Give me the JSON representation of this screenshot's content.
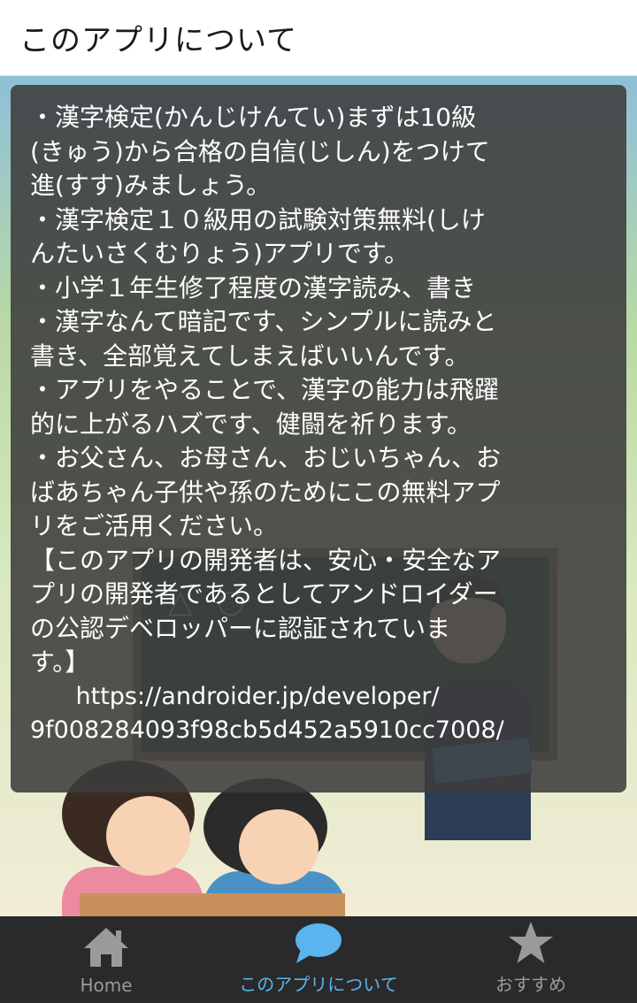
{
  "app_bar": {
    "title": "このアプリについて"
  },
  "background": {
    "board_marks": "△ ○"
  },
  "info": {
    "body": "・漢字検定(かんじけんてい)まずは10級\n(きゅう)から合格の自信(じしん)をつけて\n進(すす)みましょう。\n・漢字検定１０級用の試験対策無料(しけ\nんたいさくむりょう)アプリです。\n・小学１年生修了程度の漢字読み、書き\n・漢字なんて暗記です、シンプルに読みと\n書き、全部覚えてしまえばいいんです。\n・アプリをやることで、漢字の能力は飛躍\n的に上がるハズです、健闘を祈ります。\n・お父さん、お母さん、おじいちゃん、お\nばあちゃん子供や孫のためにこの無料アプ\nリをご活用ください。\n【このアプリの開発者は、安心・安全なア\nプリの開発者であるとしてアンドロイダー\nの公認デベロッパーに認証されていま\nす。】",
    "url": "      https://androider.jp/developer/\n9f008284093f98cb5d452a5910cc7008/"
  },
  "bottom_nav": {
    "items": [
      {
        "label": "Home",
        "icon": "home-icon",
        "active": false
      },
      {
        "label": "このアプリについて",
        "icon": "chat-bubble-icon",
        "active": true
      },
      {
        "label": "おすすめ",
        "icon": "star-icon",
        "active": false
      }
    ]
  },
  "colors": {
    "active_tab": "#5ab4ee",
    "inactive_tab": "#9a9a9a",
    "nav_background": "#2a2a2a",
    "card_background": "rgba(60,60,60,0.88)"
  }
}
